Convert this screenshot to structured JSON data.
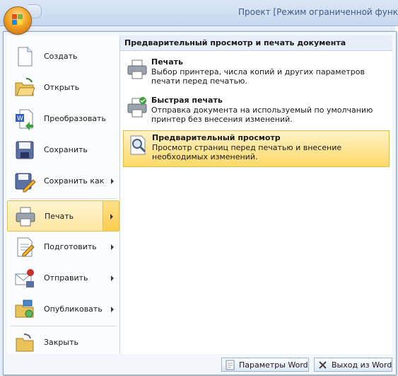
{
  "window": {
    "title": "Проект [Режим ограниченной функ"
  },
  "office_button": {
    "name": "office-button"
  },
  "left_menu": {
    "items": [
      {
        "label": "Создать",
        "icon": "new-document-icon",
        "submenu": false
      },
      {
        "label": "Открыть",
        "icon": "open-folder-icon",
        "submenu": false
      },
      {
        "label": "Преобразовать",
        "icon": "convert-document-icon",
        "submenu": false
      },
      {
        "label": "Сохранить",
        "icon": "save-disk-icon",
        "submenu": false
      },
      {
        "label": "Сохранить как",
        "icon": "save-as-icon",
        "submenu": true
      },
      {
        "label": "Печать",
        "icon": "printer-icon",
        "submenu": true,
        "active": true
      },
      {
        "label": "Подготовить",
        "icon": "prepare-document-icon",
        "submenu": true
      },
      {
        "label": "Отправить",
        "icon": "send-icon",
        "submenu": true
      },
      {
        "label": "Опубликовать",
        "icon": "publish-icon",
        "submenu": true
      },
      {
        "label": "Закрыть",
        "icon": "close-folder-icon",
        "submenu": false
      }
    ]
  },
  "print_panel": {
    "header": "Предварительный просмотр и печать документа",
    "options": [
      {
        "title": "Печать",
        "description": "Выбор принтера, числа копий и других параметров печати перед печатью.",
        "icon": "printer-icon"
      },
      {
        "title": "Быстрая печать",
        "description": "Отправка документа на используемый по умолчанию принтер без внесения изменений.",
        "icon": "quick-print-icon"
      },
      {
        "title": "Предварительный просмотр",
        "description": "Просмотр страниц перед печатью и внесение необходимых изменений.",
        "icon": "print-preview-icon",
        "highlighted": true
      }
    ]
  },
  "footer": {
    "word_options": "Параметры Word",
    "exit_word": "Выход из Word"
  }
}
